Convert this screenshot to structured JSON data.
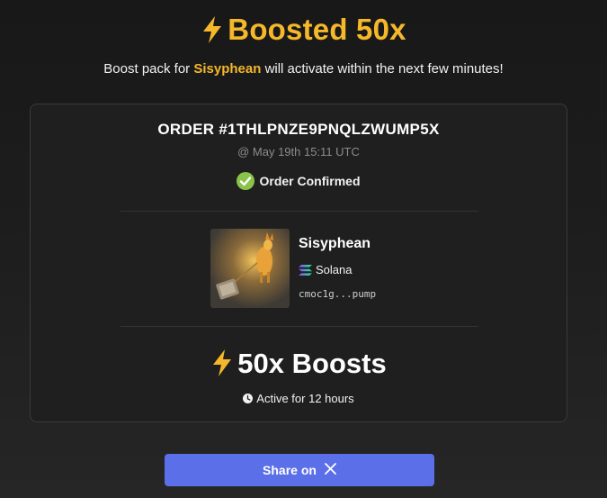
{
  "header": {
    "title": "Boosted 50x",
    "subtitle_prefix": "Boost pack for",
    "token_name": "Sisyphean",
    "subtitle_suffix": "will activate within the next few minutes!"
  },
  "order": {
    "id": "ORDER #1THLPNZE9PNQLZWUMP5X",
    "date": "@ May 19th 15:11 UTC",
    "status": "Order Confirmed"
  },
  "token": {
    "name": "Sisyphean",
    "chain": "Solana",
    "address": "cmoc1g...pump"
  },
  "boost": {
    "label": "50x Boosts",
    "duration": "Active for 12 hours"
  },
  "share": {
    "label": "Share on"
  },
  "colors": {
    "accent": "#f5b82a",
    "button": "#5a6fe8",
    "confirmed": "#8bc34a"
  },
  "icons": [
    "lightning-icon",
    "check-circle-icon",
    "solana-icon",
    "clock-icon",
    "x-logo-icon"
  ]
}
